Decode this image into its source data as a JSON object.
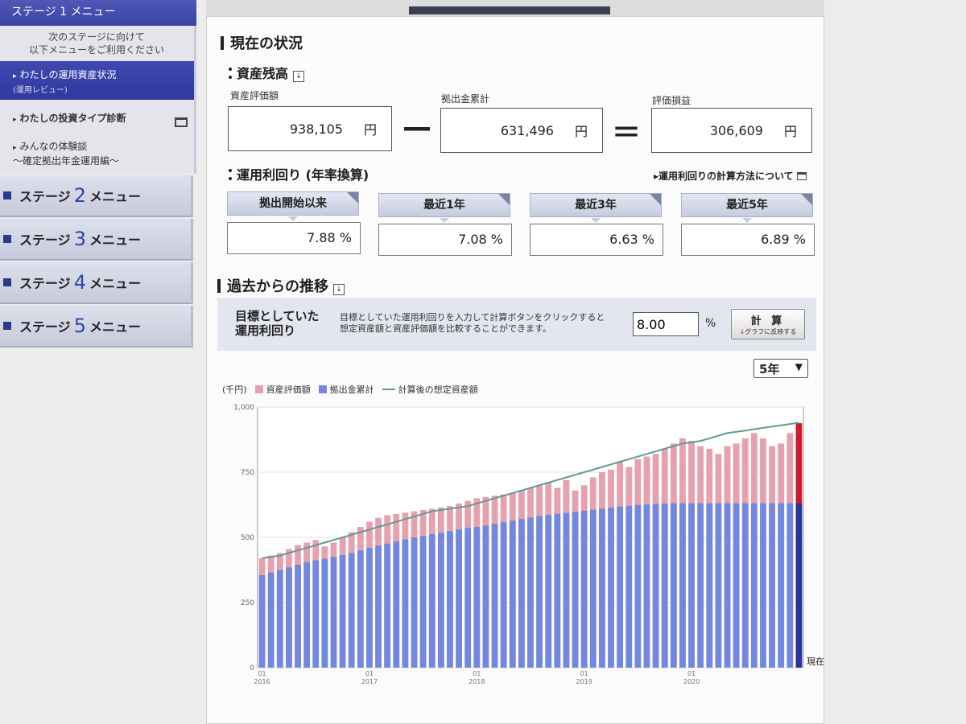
{
  "sidebar": {
    "stage1_header": "ステージ 1 メニュー",
    "note_line1": "次のステージに向けて",
    "note_line2": "以下メニューをご利用ください",
    "items": [
      {
        "label": "わたしの運用資産状況",
        "sub": "(運用レビュー)"
      },
      {
        "label": "わたしの投資タイプ診断"
      },
      {
        "label_line1": "みんなの体験談",
        "label_line2": "～確定拠出年金運用編～"
      }
    ],
    "stages": [
      {
        "prefix": "ステージ",
        "num": "2",
        "suffix": "メニュー"
      },
      {
        "prefix": "ステージ",
        "num": "3",
        "suffix": "メニュー"
      },
      {
        "prefix": "ステージ",
        "num": "4",
        "suffix": "メニュー"
      },
      {
        "prefix": "ステージ",
        "num": "5",
        "suffix": "メニュー"
      }
    ]
  },
  "main": {
    "section_title": "現在の状況",
    "balance": {
      "title": "資産残高",
      "asset_label": "資産評価額",
      "asset_value": "938,105",
      "contrib_label": "拠出金累計",
      "contrib_value": "631,496",
      "gain_label": "評価損益",
      "gain_value": "306,609",
      "unit": "円",
      "minus": "—",
      "equals": "＝"
    },
    "yield": {
      "title": "運用利回り (年率換算)",
      "link": "運用利回りの計算方法について",
      "periods": [
        {
          "label": "拠出開始以来",
          "value": "7.88 %"
        },
        {
          "label": "最近1年",
          "value": "7.08 %"
        },
        {
          "label": "最近3年",
          "value": "6.63 %"
        },
        {
          "label": "最近5年",
          "value": "6.89 %"
        }
      ]
    },
    "history": {
      "title": "過去からの推移",
      "target_title_line1": "目標としていた",
      "target_title_line2": "運用利回り",
      "desc_line1": "目標としていた運用利回りを入力して計算ボタンをクリックすると",
      "desc_line2": "想定資産額と資産評価額を比較することができます。",
      "target_value": "8.00",
      "target_unit": "%",
      "calc_label": "計 算",
      "calc_sub": "グラフに反映する",
      "period_select": "5年"
    }
  },
  "colors": {
    "asset_bar": "#e6a0ae",
    "asset_bar_last": "#d01a2c",
    "contrib_bar": "#7288e0",
    "contrib_bar_last": "#27359a",
    "target_line": "#5f9a9a",
    "sidebar_active": "#3a43a2"
  },
  "chart_data": {
    "type": "bar",
    "unit_label": "(千円)",
    "legend": [
      "資産評価額",
      "拠出金累計",
      "計算後の想定資産額"
    ],
    "ylim": [
      0,
      1000
    ],
    "yticks": [
      0,
      250,
      500,
      750,
      "1,000"
    ],
    "x_tick_labels": [
      {
        "idx": 0,
        "top": "01",
        "bottom": "2016"
      },
      {
        "idx": 12,
        "top": "01",
        "bottom": "2017"
      },
      {
        "idx": 24,
        "top": "01",
        "bottom": "2018"
      },
      {
        "idx": 36,
        "top": "01",
        "bottom": "2019"
      },
      {
        "idx": 48,
        "top": "01",
        "bottom": "2020"
      }
    ],
    "now_label": "現在",
    "series": [
      {
        "name": "資産評価額",
        "values": [
          420,
          430,
          440,
          455,
          470,
          480,
          490,
          465,
          480,
          500,
          520,
          540,
          560,
          575,
          585,
          590,
          595,
          600,
          605,
          610,
          615,
          620,
          630,
          640,
          650,
          655,
          660,
          665,
          670,
          680,
          690,
          700,
          710,
          690,
          720,
          680,
          700,
          730,
          750,
          760,
          790,
          770,
          800,
          810,
          820,
          840,
          860,
          880,
          870,
          850,
          840,
          820,
          850,
          860,
          880,
          900,
          880,
          850,
          860,
          900,
          938
        ],
        "color_ref": "asset_bar"
      },
      {
        "name": "拠出金累計",
        "values": [
          355,
          365,
          375,
          385,
          395,
          405,
          412,
          418,
          425,
          432,
          440,
          450,
          460,
          468,
          476,
          484,
          492,
          500,
          506,
          512,
          518,
          524,
          530,
          536,
          540,
          546,
          552,
          558,
          564,
          570,
          576,
          582,
          586,
          590,
          594,
          598,
          602,
          606,
          610,
          614,
          618,
          621,
          624,
          626,
          628,
          630,
          631,
          631,
          631,
          631,
          631,
          631,
          631,
          631,
          631,
          631,
          631,
          631,
          631,
          631,
          631
        ],
        "color_ref": "contrib_bar"
      },
      {
        "name": "計算後の想定資産額",
        "values": [
          420,
          425,
          430,
          440,
          450,
          460,
          470,
          480,
          490,
          500,
          510,
          520,
          530,
          540,
          550,
          560,
          570,
          580,
          590,
          600,
          605,
          610,
          615,
          620,
          630,
          640,
          650,
          660,
          670,
          680,
          690,
          700,
          710,
          720,
          730,
          740,
          750,
          760,
          770,
          780,
          790,
          800,
          810,
          820,
          830,
          840,
          850,
          860,
          865,
          870,
          880,
          890,
          900,
          905,
          910,
          915,
          920,
          925,
          930,
          935,
          940
        ],
        "color_ref": "target_line"
      }
    ]
  }
}
